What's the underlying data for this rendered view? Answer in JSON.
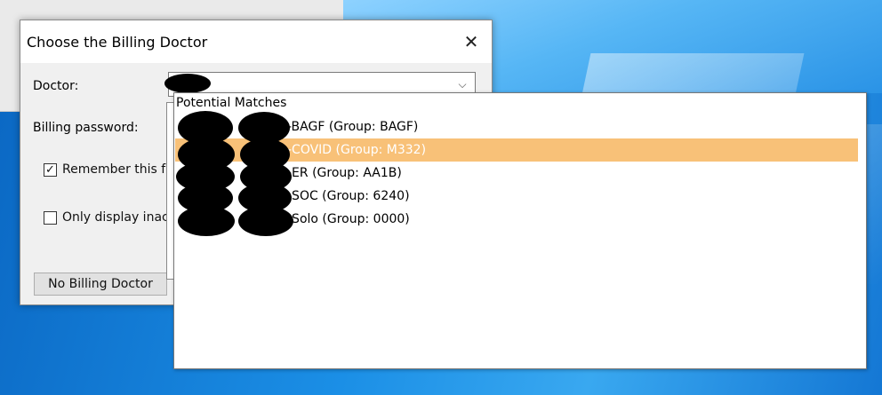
{
  "dialog": {
    "title": "Choose the Billing Doctor",
    "close_glyph": "✕",
    "doctor_label": "Doctor:",
    "billing_password_label": "Billing password:",
    "remember_label": "Remember this f",
    "remember_checked": true,
    "only_inactive_label": "Only display inac",
    "only_inactive_checked": false,
    "no_billing_doctor_button": "No Billing Doctor",
    "combo_arrow_glyph": "⌵"
  },
  "popup": {
    "header": "Potential Matches",
    "items": [
      {
        "text": "-BAGF (Group: BAGF)",
        "selected": false
      },
      {
        "text": "-COVID (Group: M332)",
        "selected": true
      },
      {
        "text": "-ER (Group: AA1B)",
        "selected": false
      },
      {
        "text": "-SOC (Group: 6240)",
        "selected": false
      },
      {
        "text": "-Solo (Group: 0000)",
        "selected": false
      }
    ]
  },
  "colors": {
    "selection": "#f8c178",
    "desktop_blue": "#1b8fe6"
  }
}
